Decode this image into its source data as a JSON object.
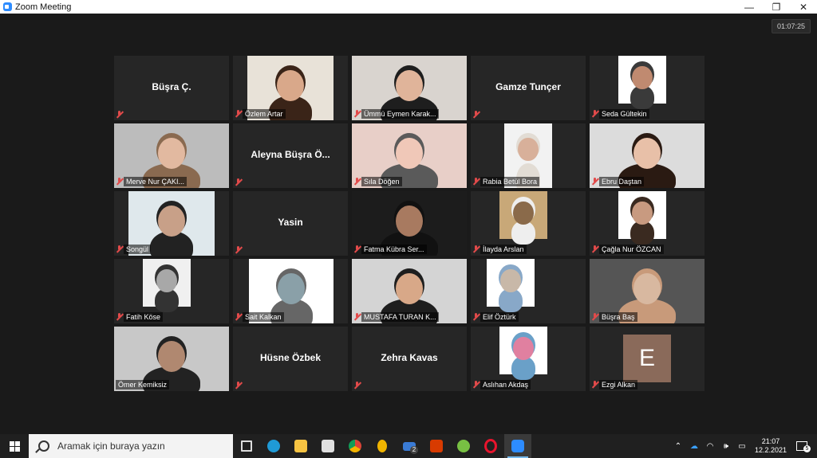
{
  "window": {
    "title": "Zoom Meeting",
    "minimize": "—",
    "restore": "❐",
    "close": "✕"
  },
  "meeting": {
    "timer": "01:07:25"
  },
  "participants": [
    {
      "name": "Büşra Ç.",
      "video": false
    },
    {
      "name": "Özlem Artar",
      "video": true
    },
    {
      "name": "Ümmü Eymen Karak...",
      "video": true
    },
    {
      "name": "Gamze Tunçer",
      "video": false
    },
    {
      "name": "Seda Gültekin",
      "video": true
    },
    {
      "name": "Merve Nur ÇAKI...",
      "video": true
    },
    {
      "name": "Aleyna Büşra Ö...",
      "video": false
    },
    {
      "name": "Sıla Döğen",
      "video": true
    },
    {
      "name": "Rabia Betül Bora",
      "video": true
    },
    {
      "name": "Ebru Daştan",
      "video": true
    },
    {
      "name": "Songül",
      "video": true
    },
    {
      "name": "Yasin",
      "video": false
    },
    {
      "name": "Fatma Kübra Ser...",
      "video": true
    },
    {
      "name": "İlayda Arslan",
      "video": true
    },
    {
      "name": "Çağla Nur ÖZCAN",
      "video": true
    },
    {
      "name": "Fatih Köse",
      "video": true
    },
    {
      "name": "Sait Kalkan",
      "video": true
    },
    {
      "name": "MUSTAFA TURAN K...",
      "video": true
    },
    {
      "name": "Elif Öztürk",
      "video": true
    },
    {
      "name": "Büşra Baş",
      "video": true
    },
    {
      "name": "Ömer Kemiksiz",
      "video": true,
      "speaking": true
    },
    {
      "name": "Hüsne Özbek",
      "video": false
    },
    {
      "name": "Zehra Kavas",
      "video": false
    },
    {
      "name": "Aslıhan Akdaş",
      "video": true
    },
    {
      "name": "Ezgi Alkan",
      "video": false,
      "avatar_letter": "E"
    }
  ],
  "taskbar": {
    "search_placeholder": "Aramak için buraya yazın",
    "time": "21:07",
    "date": "12.2.2021",
    "notification_count": "5",
    "mail_badge": "2"
  },
  "colors": {
    "speaking_border": "#e6e06a",
    "muted_mic": "#e24a4a",
    "tile_bg": "#262626"
  }
}
